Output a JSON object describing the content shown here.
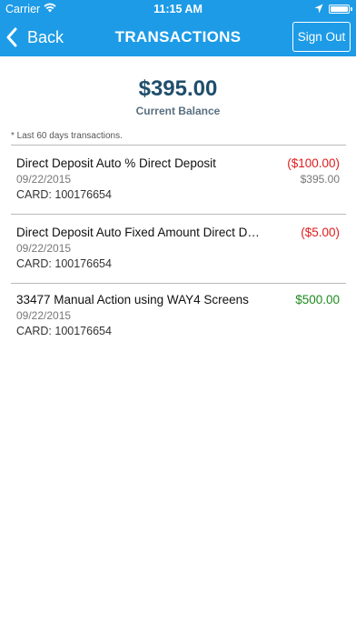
{
  "status_bar": {
    "carrier": "Carrier",
    "time": "11:15 AM"
  },
  "nav": {
    "back_label": "Back",
    "title": "TRANSACTIONS",
    "signout_label": "Sign Out",
    "background_color": "#1d9be7"
  },
  "summary": {
    "balance": "$395.00",
    "balance_label": "Current Balance",
    "note": "* Last 60 days transactions."
  },
  "transactions": [
    {
      "description": "Direct Deposit Auto % Direct Deposit",
      "date": "09/22/2015",
      "card": "CARD: 100176654",
      "amount": "($100.00)",
      "running_balance": "$395.00"
    },
    {
      "description": "Direct Deposit Auto Fixed Amount Direct Deposit",
      "date": "09/22/2015",
      "card": "CARD: 100176654",
      "amount": "($5.00)"
    },
    {
      "description": "33477 Manual Action using WAY4 Screens",
      "date": "09/22/2015",
      "card": "CARD: 100176654",
      "amount": "$500.00"
    }
  ],
  "colors": {
    "negative": "#e01b1b",
    "positive": "#1d8a1d",
    "balance_text": "#1f4e6c"
  }
}
